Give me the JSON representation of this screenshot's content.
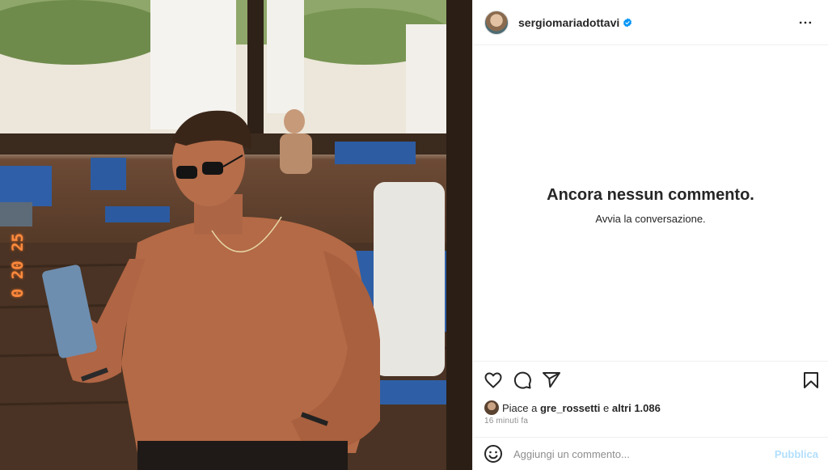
{
  "post": {
    "username": "sergiomariadottavi",
    "verified": true,
    "photo_date_stamp": "0 20 25"
  },
  "comments": {
    "empty_title": "Ancora nessun commento.",
    "empty_subtitle": "Avvia la conversazione."
  },
  "likes": {
    "prefix": "Piace a ",
    "liker": "gre_rossetti",
    "connector": " e ",
    "others": "altri 1.086"
  },
  "timestamp": "16 minuti fa",
  "comment_box": {
    "placeholder": "Aggiungi un commento...",
    "publish_label": "Pubblica"
  },
  "icons": {
    "header": [
      "avatar",
      "verified-badge-icon",
      "more-options-icon"
    ],
    "actions": [
      "heart-icon",
      "comment-icon",
      "share-icon",
      "bookmark-icon"
    ],
    "composer": [
      "emoji-icon"
    ]
  },
  "colors": {
    "accent_blue": "#0095f6",
    "publish_disabled": "#b2dffc",
    "text": "#262626",
    "muted": "#8e8e8e"
  }
}
